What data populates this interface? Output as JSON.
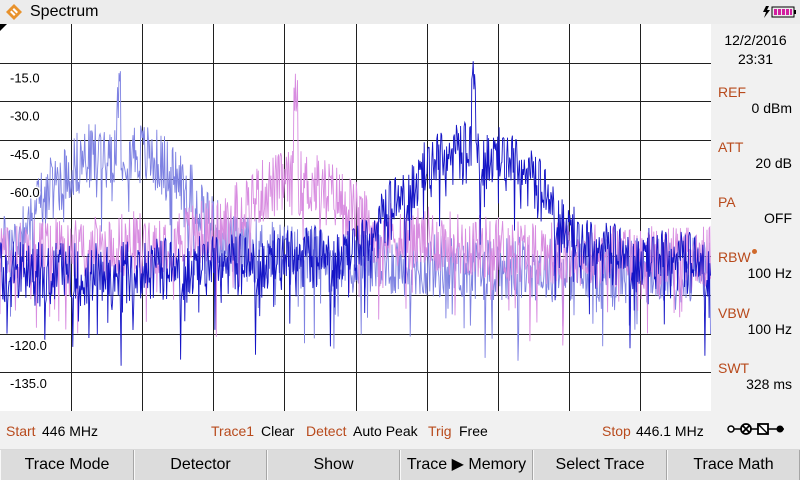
{
  "header": {
    "title": "Spectrum",
    "icons": [
      "rs-diamond-logo-icon",
      "battery-charging-icon"
    ]
  },
  "chart_data": {
    "type": "line",
    "title": "",
    "xlabel": "",
    "ylabel": "",
    "ylim": [
      -146,
      6
    ],
    "y_ticks": [
      -15.0,
      -30.0,
      -45.0,
      -60.0,
      -120.0,
      -135.0
    ],
    "y_tick_labels": [
      "-15.0",
      "-30.0",
      "-45.0",
      "-60.0",
      "-120.0",
      "-135.0"
    ],
    "grid": true,
    "x_start": "446 MHz",
    "x_stop": "446.1 MHz",
    "series": [
      {
        "color": "#7e82e2",
        "peak_fraction": 0.167,
        "peak_dbm": -17,
        "hump_dbm": -42,
        "floor_dbm": -90
      },
      {
        "color": "#d88ce0",
        "peak_fraction": 0.416,
        "peak_dbm": -19,
        "hump_dbm": -55,
        "floor_dbm": -86
      },
      {
        "color": "#1414c6",
        "peak_fraction": 0.666,
        "peak_dbm": -14,
        "hump_dbm": -44,
        "floor_dbm": -92
      }
    ]
  },
  "right_panel": {
    "date": "12/2/2016",
    "time": "23:31",
    "ref_label": "REF",
    "ref_value": "0 dBm",
    "att_label": "ATT",
    "att_value": "20 dB",
    "pa_label": "PA",
    "pa_value": "OFF",
    "rbw_label": "RBW",
    "rbw_value": "100 Hz",
    "vbw_label": "VBW",
    "vbw_value": "100 Hz",
    "swt_label": "SWT",
    "swt_value": "328 ms"
  },
  "status": {
    "start_label": "Start",
    "start_value": "446 MHz",
    "trace_label": "Trace1",
    "trace_value": "Clear",
    "detect_label": "Detect",
    "detect_value": "Auto Peak",
    "trig_label": "Trig",
    "trig_value": "Free",
    "stop_label": "Stop",
    "stop_value": "446.1 MHz"
  },
  "softkeys": [
    "Trace Mode",
    "Detector",
    "Show",
    "Trace ▶  Memory",
    "Select Trace",
    "Trace Math"
  ]
}
